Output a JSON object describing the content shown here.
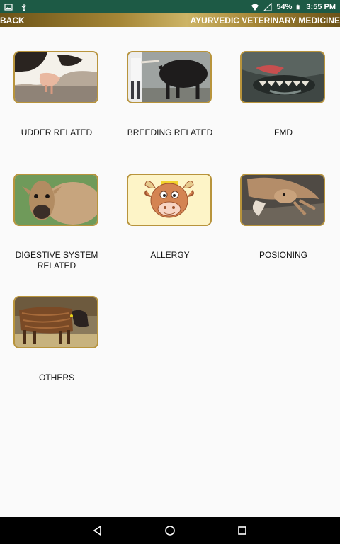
{
  "status_bar": {
    "battery_text": "54%",
    "time_text": "3:55 PM",
    "icons": [
      "image-icon",
      "usb-icon",
      "wifi-icon",
      "signal-icon",
      "battery-icon"
    ]
  },
  "app_bar": {
    "back_label": "BACK",
    "title": "AYURVEDIC VETERINARY MEDICINE"
  },
  "categories": [
    {
      "label": "UDDER RELATED",
      "image": "cow-udder-photo"
    },
    {
      "label": "BREEDING RELATED",
      "image": "breeding-cow-photo"
    },
    {
      "label": "FMD",
      "image": "cow-mouth-lesion-photo"
    },
    {
      "label": "DIGESTIVE SYSTEM RELATED",
      "image": "cow-face-photo"
    },
    {
      "label": "ALLERGY",
      "image": "cartoon-cow-icon"
    },
    {
      "label": "POSIONING",
      "image": "lying-cow-photo"
    },
    {
      "label": "OTHERS",
      "image": "sick-cow-photo"
    }
  ],
  "nav_bar": {
    "buttons": [
      "back-triangle-icon",
      "home-circle-icon",
      "recents-square-icon"
    ]
  },
  "colors": {
    "status_bar": "#1d5a45",
    "app_bar_gold": "#a58636",
    "tile_border": "#b8943c",
    "background": "#fafafa"
  }
}
